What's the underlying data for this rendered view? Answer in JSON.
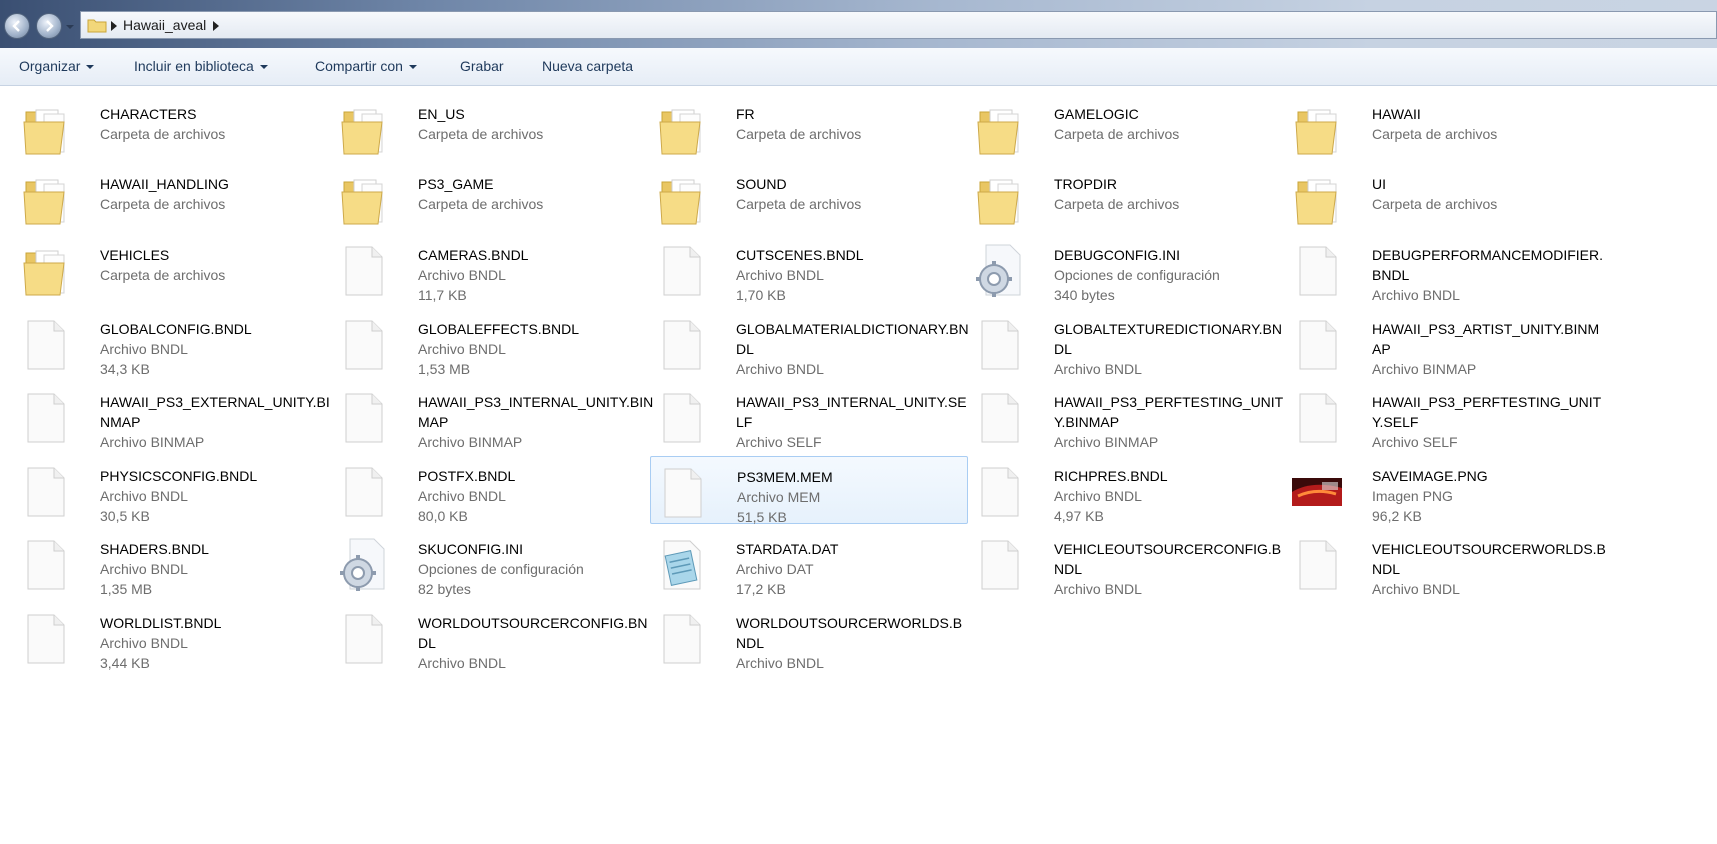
{
  "window": {
    "breadcrumb": [
      "Hawaii_aveal"
    ]
  },
  "toolbar": {
    "organize": "Organizar",
    "include": "Incluir en biblioteca",
    "share": "Compartir con",
    "burn": "Grabar",
    "new_folder": "Nueva carpeta"
  },
  "colors": {
    "folder": "#f2d77a",
    "toolbar_text": "#1e395b",
    "selection_border": "#a9cdf3",
    "meta_text": "#6d6d6d"
  },
  "items": [
    {
      "name": "CHARACTERS",
      "line2": "Carpeta de archivos",
      "line3": "",
      "icon": "folder-icon"
    },
    {
      "name": "EN_US",
      "line2": "Carpeta de archivos",
      "line3": "",
      "icon": "folder-icon"
    },
    {
      "name": "FR",
      "line2": "Carpeta de archivos",
      "line3": "",
      "icon": "folder-icon"
    },
    {
      "name": "GAMELOGIC",
      "line2": "Carpeta de archivos",
      "line3": "",
      "icon": "folder-icon"
    },
    {
      "name": "HAWAII",
      "line2": "Carpeta de archivos",
      "line3": "",
      "icon": "folder-icon"
    },
    {
      "name": "HAWAII_HANDLING",
      "line2": "Carpeta de archivos",
      "line3": "",
      "icon": "folder-icon"
    },
    {
      "name": "PS3_GAME",
      "line2": "Carpeta de archivos",
      "line3": "",
      "icon": "folder-icon"
    },
    {
      "name": "SOUND",
      "line2": "Carpeta de archivos",
      "line3": "",
      "icon": "folder-icon"
    },
    {
      "name": "TROPDIR",
      "line2": "Carpeta de archivos",
      "line3": "",
      "icon": "folder-icon"
    },
    {
      "name": "UI",
      "line2": "Carpeta de archivos",
      "line3": "",
      "icon": "folder-icon"
    },
    {
      "name": "VEHICLES",
      "line2": "Carpeta de archivos",
      "line3": "",
      "icon": "folder-icon"
    },
    {
      "name": "CAMERAS.BNDL",
      "line2": "Archivo BNDL",
      "line3": "11,7 KB",
      "icon": "file-icon"
    },
    {
      "name": "CUTSCENES.BNDL",
      "line2": "Archivo BNDL",
      "line3": "1,70 KB",
      "icon": "file-icon"
    },
    {
      "name": "DEBUGCONFIG.INI",
      "line2": "Opciones de configuración",
      "line3": "340 bytes",
      "icon": "config-file-icon"
    },
    {
      "name": "DEBUGPERFORMANCEMODIFIER.BNDL",
      "line2": "Archivo BNDL",
      "line3": "",
      "icon": "file-icon"
    },
    {
      "name": "GLOBALCONFIG.BNDL",
      "line2": "Archivo BNDL",
      "line3": "34,3 KB",
      "icon": "file-icon"
    },
    {
      "name": "GLOBALEFFECTS.BNDL",
      "line2": "Archivo BNDL",
      "line3": "1,53 MB",
      "icon": "file-icon"
    },
    {
      "name": "GLOBALMATERIALDICTIONARY.BNDL",
      "line2": "Archivo BNDL",
      "line3": "",
      "icon": "file-icon"
    },
    {
      "name": "GLOBALTEXTUREDICTIONARY.BNDL",
      "line2": "Archivo BNDL",
      "line3": "",
      "icon": "file-icon"
    },
    {
      "name": "HAWAII_PS3_ARTIST_UNITY.BINMAP",
      "line2": "Archivo BINMAP",
      "line3": "",
      "icon": "file-icon"
    },
    {
      "name": "HAWAII_PS3_EXTERNAL_UNITY.BINMAP",
      "line2": "Archivo BINMAP",
      "line3": "",
      "icon": "file-icon"
    },
    {
      "name": "HAWAII_PS3_INTERNAL_UNITY.BINMAP",
      "line2": "Archivo BINMAP",
      "line3": "",
      "icon": "file-icon"
    },
    {
      "name": "HAWAII_PS3_INTERNAL_UNITY.SELF",
      "line2": "Archivo SELF",
      "line3": "",
      "icon": "file-icon"
    },
    {
      "name": "HAWAII_PS3_PERFTESTING_UNITY.BINMAP",
      "line2": "Archivo BINMAP",
      "line3": "",
      "icon": "file-icon"
    },
    {
      "name": "HAWAII_PS3_PERFTESTING_UNITY.SELF",
      "line2": "Archivo SELF",
      "line3": "",
      "icon": "file-icon"
    },
    {
      "name": "PHYSICSCONFIG.BNDL",
      "line2": "Archivo BNDL",
      "line3": "30,5 KB",
      "icon": "file-icon"
    },
    {
      "name": "POSTFX.BNDL",
      "line2": "Archivo BNDL",
      "line3": "80,0 KB",
      "icon": "file-icon"
    },
    {
      "name": "PS3MEM.MEM",
      "line2": "Archivo MEM",
      "line3": "51,5 KB",
      "icon": "file-icon",
      "selected": true
    },
    {
      "name": "RICHPRES.BNDL",
      "line2": "Archivo BNDL",
      "line3": "4,97 KB",
      "icon": "file-icon"
    },
    {
      "name": "SAVEIMAGE.PNG",
      "line2": "Imagen PNG",
      "line3": "96,2 KB",
      "icon": "image-thumbnail-icon"
    },
    {
      "name": "SHADERS.BNDL",
      "line2": "Archivo BNDL",
      "line3": "1,35 MB",
      "icon": "file-icon"
    },
    {
      "name": "SKUCONFIG.INI",
      "line2": "Opciones de configuración",
      "line3": "82 bytes",
      "icon": "config-file-icon"
    },
    {
      "name": "STARDATA.DAT",
      "line2": "Archivo DAT",
      "line3": "17,2 KB",
      "icon": "notepad-file-icon"
    },
    {
      "name": "VEHICLEOUTSOURCERCONFIG.BNDL",
      "line2": "Archivo BNDL",
      "line3": "",
      "icon": "file-icon"
    },
    {
      "name": "VEHICLEOUTSOURCERWORLDS.BNDL",
      "line2": "Archivo BNDL",
      "line3": "",
      "icon": "file-icon"
    },
    {
      "name": "WORLDLIST.BNDL",
      "line2": "Archivo BNDL",
      "line3": "3,44 KB",
      "icon": "file-icon"
    },
    {
      "name": "WORLDOUTSOURCERCONFIG.BNDL",
      "line2": "Archivo BNDL",
      "line3": "",
      "icon": "file-icon"
    },
    {
      "name": "WORLDOUTSOURCERWORLDS.BNDL",
      "line2": "Archivo BNDL",
      "line3": "",
      "icon": "file-icon"
    }
  ]
}
